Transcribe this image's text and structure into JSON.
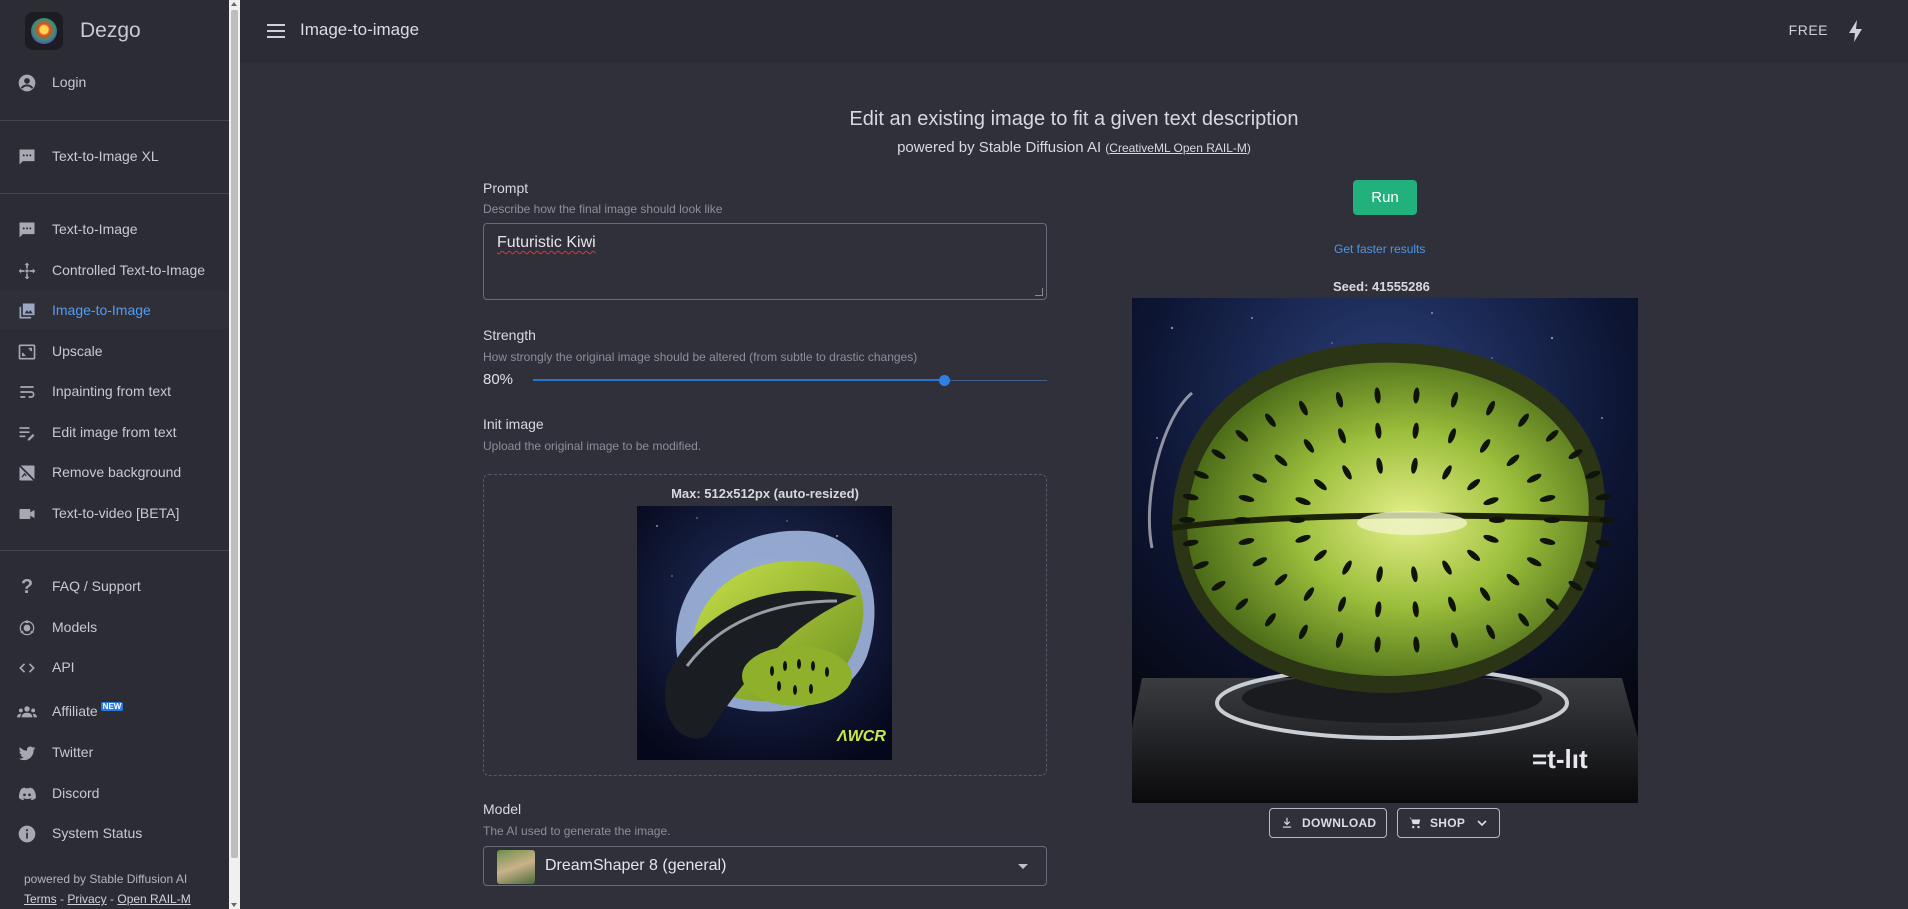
{
  "sidebar": {
    "brand": "Dezgo",
    "login": "Login",
    "items_top": [
      "Text-to-Image XL"
    ],
    "items_mid": [
      "Text-to-Image",
      "Controlled Text-to-Image",
      "Image-to-Image",
      "Upscale",
      "Inpainting from text",
      "Edit image from text",
      "Remove background",
      "Text-to-video [BETA]"
    ],
    "items_bottom": [
      "FAQ / Support",
      "Models",
      "API",
      "Affiliate",
      "Twitter",
      "Discord",
      "System Status"
    ],
    "new_badge": "NEW",
    "footer": "powered by Stable Diffusion AI",
    "links": [
      "Terms",
      "Privacy",
      "Open RAIL-M"
    ]
  },
  "topbar": {
    "title": "Image-to-image",
    "free": "FREE"
  },
  "main": {
    "title": "Edit an existing image to fit a given text description",
    "powered": "powered by Stable Diffusion AI",
    "license": "CreativeML Open RAIL-M",
    "prompt": {
      "label": "Prompt",
      "hint": "Describe how the final image should look like",
      "value": "Futuristic Kiwi"
    },
    "strength": {
      "label": "Strength",
      "hint": "How strongly the original image should be altered (from subtle to drastic changes)",
      "value_text": "80%",
      "value": 0.8
    },
    "init": {
      "label": "Init image",
      "hint": "Upload the original image to be modified.",
      "max": "Max: 512x512px (auto-resized)"
    },
    "model": {
      "label": "Model",
      "hint": "The AI used to generate the image.",
      "value": "DreamShaper 8 (general)"
    }
  },
  "output": {
    "run": "Run",
    "faster": "Get faster results",
    "seed": "Seed: 41555286",
    "download": "DOWNLOAD",
    "shop": "SHOP"
  },
  "colors": {
    "accent": "#4f9df7",
    "run": "#22b07d",
    "link": "#4f95e6"
  }
}
